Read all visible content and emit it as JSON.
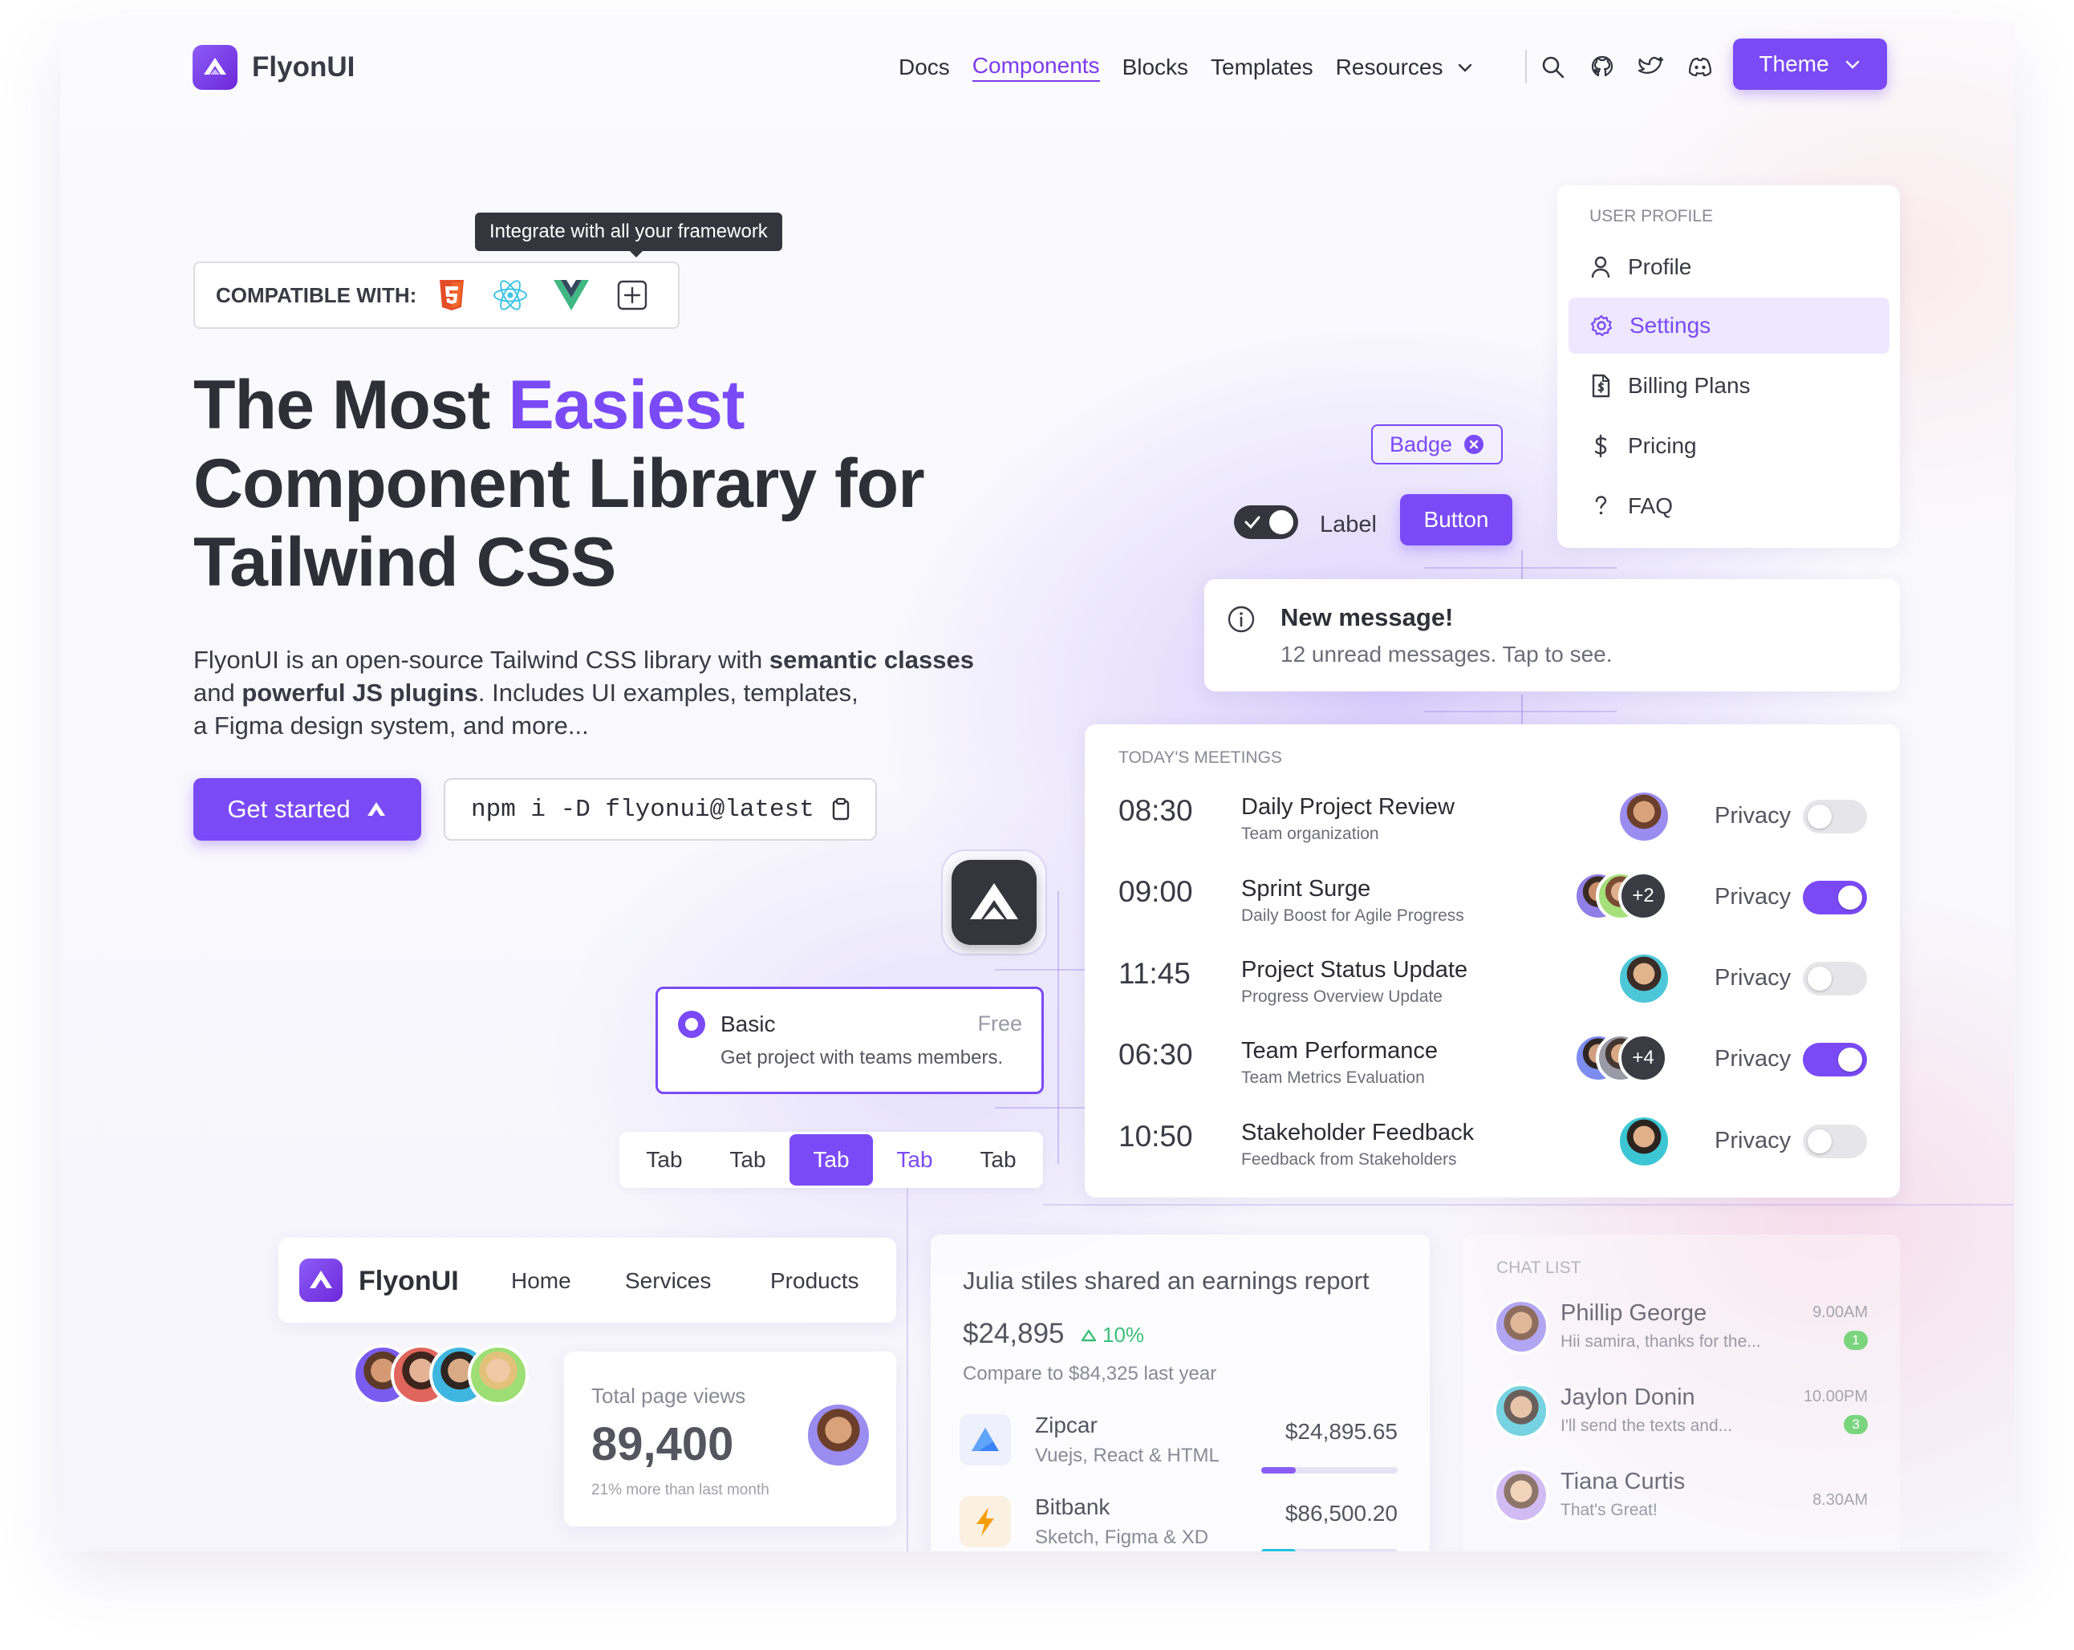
{
  "brand": {
    "name": "FlyonUI",
    "accent": "#7a4af6"
  },
  "nav": {
    "docs": "Docs",
    "components": "Components",
    "blocks": "Blocks",
    "templates": "Templates",
    "resources": "Resources",
    "theme": "Theme"
  },
  "hero": {
    "tooltip": "Integrate with all your framework",
    "compatible_label": "COMPATIBLE WITH:",
    "title_line1_a": "The Most ",
    "title_line1_b": "Easiest",
    "title_line2": "Component Library for",
    "title_line3": "Tailwind CSS",
    "desc_1": "FlyonUI is an open-source Tailwind CSS library with ",
    "desc_bold1": "semantic classes",
    "desc_2": "and ",
    "desc_bold2": "powerful JS plugins",
    "desc_3": ". Includes UI examples, templates,",
    "desc_4": "a Figma design system, and more...",
    "get_started": "Get started",
    "install_cmd": "npm i -D flyonui@latest"
  },
  "user_menu": {
    "heading": "USER PROFILE",
    "items": [
      {
        "label": "Profile",
        "icon": "user-icon"
      },
      {
        "label": "Settings",
        "icon": "gear-icon",
        "active": true
      },
      {
        "label": "Billing Plans",
        "icon": "file-dollar-icon"
      },
      {
        "label": "Pricing",
        "icon": "dollar-icon"
      },
      {
        "label": "FAQ",
        "icon": "question-icon"
      }
    ]
  },
  "widgets": {
    "badge": "Badge",
    "toggle_label": "Label",
    "button": "Button"
  },
  "alert": {
    "title": "New message!",
    "text": "12 unread messages. Tap to see."
  },
  "meetings": {
    "heading": "TODAY'S MEETINGS",
    "rows": [
      {
        "time": "08:30",
        "title": "Daily Project Review",
        "sub": "Team organization",
        "privacy": "Privacy",
        "on": false,
        "extra": ""
      },
      {
        "time": "09:00",
        "title": "Sprint Surge",
        "sub": "Daily Boost for Agile Progress",
        "privacy": "Privacy",
        "on": true,
        "extra": "+2"
      },
      {
        "time": "11:45",
        "title": "Project Status Update",
        "sub": "Progress Overview Update",
        "privacy": "Privacy",
        "on": false,
        "extra": ""
      },
      {
        "time": "06:30",
        "title": "Team Performance",
        "sub": "Team Metrics Evaluation",
        "privacy": "Privacy",
        "on": true,
        "extra": "+4"
      },
      {
        "time": "10:50",
        "title": "Stakeholder Feedback",
        "sub": "Feedback from Stakeholders",
        "privacy": "Privacy",
        "on": false,
        "extra": ""
      }
    ]
  },
  "radio_card": {
    "title": "Basic",
    "price": "Free",
    "desc": "Get project with teams members."
  },
  "tabs": [
    "Tab",
    "Tab",
    "Tab",
    "Tab",
    "Tab"
  ],
  "mini_nav": {
    "brand": "FlyonUI",
    "home": "Home",
    "services": "Services",
    "products": "Products"
  },
  "stats": {
    "label": "Total page views",
    "value": "89,400",
    "note": "21% more than last month"
  },
  "earnings": {
    "title": "Julia stiles shared an earnings report",
    "amount": "$24,895",
    "change": "10%",
    "compare": "Compare to $84,325 last year",
    "items": [
      {
        "name": "Zipcar",
        "tech": "Vuejs, React & HTML",
        "value": "$24,895.65",
        "progress": 0.25,
        "color": "#8a5cf6"
      },
      {
        "name": "Bitbank",
        "tech": "Sketch, Figma & XD",
        "value": "$86,500.20",
        "progress": 0.25,
        "color": "#22c3d9"
      }
    ]
  },
  "chat": {
    "heading": "CHAT LIST",
    "rows": [
      {
        "name": "Phillip George",
        "msg": "Hii samira, thanks for the...",
        "time": "9.00AM",
        "badge": "1"
      },
      {
        "name": "Jaylon Donin",
        "msg": "I'll send the texts and...",
        "time": "10.00PM",
        "badge": "3"
      },
      {
        "name": "Tiana Curtis",
        "msg": "That's Great!",
        "time": "8.30AM",
        "badge": ""
      }
    ]
  }
}
